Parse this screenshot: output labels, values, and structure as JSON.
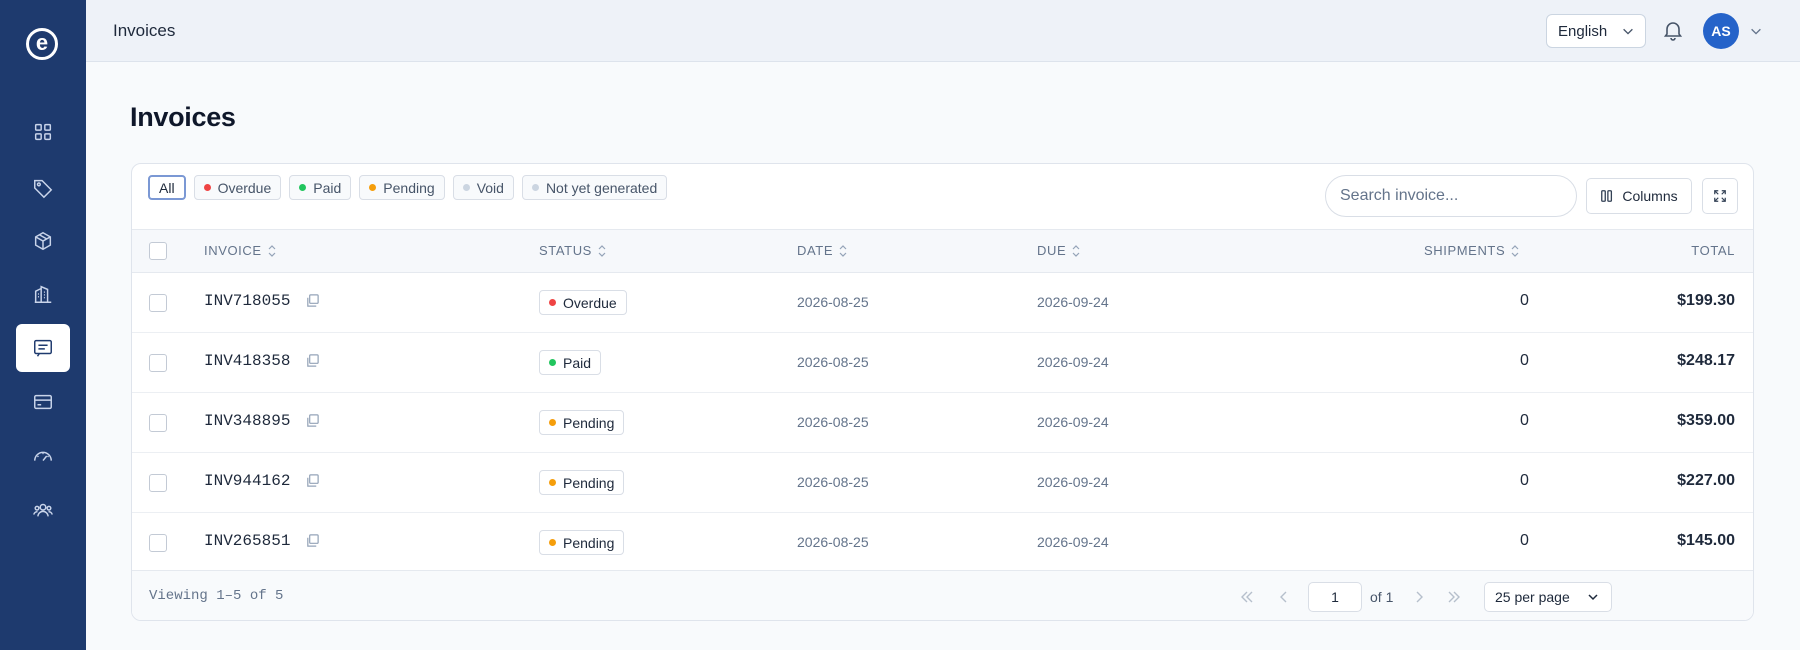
{
  "app": {
    "logo_letter": "e"
  },
  "topbar": {
    "title": "Invoices",
    "language": "English",
    "avatar_initials": "AS"
  },
  "page": {
    "title": "Invoices"
  },
  "sidebar": {
    "items": [
      {
        "icon": "dashboard-grid-icon",
        "active": false
      },
      {
        "icon": "tag-icon",
        "active": false
      },
      {
        "icon": "package-icon",
        "active": false
      },
      {
        "icon": "building-icon",
        "active": false
      },
      {
        "icon": "invoice-icon",
        "active": true
      },
      {
        "icon": "credit-card-icon",
        "active": false
      },
      {
        "icon": "gauge-icon",
        "active": false
      },
      {
        "icon": "users-icon",
        "active": false
      }
    ]
  },
  "filters": [
    {
      "label": "All",
      "active": true
    },
    {
      "label": "Overdue",
      "color": "#ef4444"
    },
    {
      "label": "Paid",
      "color": "#22c55e"
    },
    {
      "label": "Pending",
      "color": "#f59e0b"
    },
    {
      "label": "Void",
      "color": "#cbd5e1"
    },
    {
      "label": "Not yet generated",
      "color": "#cbd5e1"
    }
  ],
  "search": {
    "placeholder": "Search invoice..."
  },
  "toolbar": {
    "columns_label": "Columns"
  },
  "table": {
    "headers": {
      "invoice": "INVOICE",
      "status": "STATUS",
      "date": "DATE",
      "due": "DUE",
      "shipments": "SHIPMENTS",
      "total": "TOTAL"
    },
    "rows": [
      {
        "invoice": "INV718055",
        "status": "Overdue",
        "status_color": "#ef4444",
        "date": "2026-08-25",
        "due": "2026-09-24",
        "shipments": "0",
        "total": "$199.30"
      },
      {
        "invoice": "INV418358",
        "status": "Paid",
        "status_color": "#22c55e",
        "date": "2026-08-25",
        "due": "2026-09-24",
        "shipments": "0",
        "total": "$248.17"
      },
      {
        "invoice": "INV348895",
        "status": "Pending",
        "status_color": "#f59e0b",
        "date": "2026-08-25",
        "due": "2026-09-24",
        "shipments": "0",
        "total": "$359.00"
      },
      {
        "invoice": "INV944162",
        "status": "Pending",
        "status_color": "#f59e0b",
        "date": "2026-08-25",
        "due": "2026-09-24",
        "shipments": "0",
        "total": "$227.00"
      },
      {
        "invoice": "INV265851",
        "status": "Pending",
        "status_color": "#f59e0b",
        "date": "2026-08-25",
        "due": "2026-09-24",
        "shipments": "0",
        "total": "$145.00"
      }
    ]
  },
  "footer": {
    "viewing": "Viewing 1–5 of 5",
    "page_value": "1",
    "of_pages": "of 1",
    "per_page": "25 per page"
  }
}
